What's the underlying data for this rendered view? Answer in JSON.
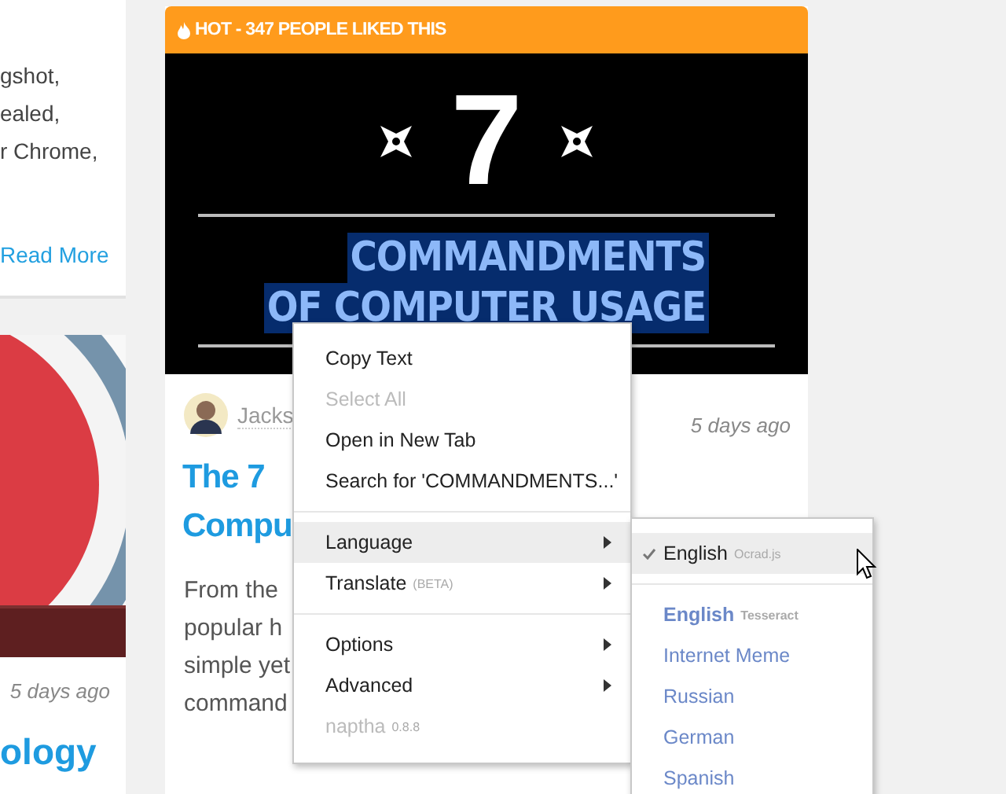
{
  "left_card": {
    "text_lines": [
      "gshot,",
      "ealed,",
      "r Chrome,"
    ],
    "link": "Read More"
  },
  "left_card_2": {
    "time": "5 days ago",
    "title": "ology"
  },
  "main_card": {
    "banner": "HOT - 347 PEOPLE LIKED THIS",
    "image": {
      "number": "7",
      "lines": [
        "COMMANDMENTS",
        "OF COMPUTER USAGE"
      ]
    },
    "author": "Jacks",
    "time": "5 days ago",
    "title_lines": [
      "The 7",
      "Compu"
    ],
    "body_lines": [
      "From the",
      "popular h",
      "simple yet",
      "command"
    ]
  },
  "context_menu": {
    "items": [
      {
        "kind": "item",
        "label": "Copy Text",
        "disabled": false,
        "highlighted": false,
        "submenu": false
      },
      {
        "kind": "item",
        "label": "Select All",
        "disabled": true,
        "highlighted": false,
        "submenu": false
      },
      {
        "kind": "item",
        "label": "Open in New Tab",
        "disabled": false,
        "highlighted": false,
        "submenu": false
      },
      {
        "kind": "item",
        "label": "Search for 'COMMANDMENTS...'",
        "disabled": false,
        "highlighted": false,
        "submenu": false
      },
      {
        "kind": "separator"
      },
      {
        "kind": "item",
        "label": "Language",
        "disabled": false,
        "highlighted": true,
        "submenu": true
      },
      {
        "kind": "item",
        "label": "Translate",
        "note": "(BETA)",
        "disabled": false,
        "highlighted": false,
        "submenu": true
      },
      {
        "kind": "separator"
      },
      {
        "kind": "item",
        "label": "Options",
        "disabled": false,
        "highlighted": false,
        "submenu": true
      },
      {
        "kind": "item",
        "label": "Advanced",
        "disabled": false,
        "highlighted": false,
        "submenu": true
      },
      {
        "kind": "footer",
        "label": "naptha",
        "note": "0.8.8"
      }
    ]
  },
  "language_menu": {
    "items": [
      {
        "kind": "item",
        "label": "English",
        "note": "Ocrad.js",
        "checked": true,
        "highlighted": true,
        "bold": false,
        "available": false
      },
      {
        "kind": "separator"
      },
      {
        "kind": "item",
        "label": "English",
        "note": "Tesseract",
        "checked": false,
        "highlighted": false,
        "bold": true,
        "available": true
      },
      {
        "kind": "item",
        "label": "Internet Meme",
        "checked": false,
        "highlighted": false,
        "bold": false,
        "available": true
      },
      {
        "kind": "item",
        "label": "Russian",
        "checked": false,
        "highlighted": false,
        "bold": false,
        "available": true
      },
      {
        "kind": "item",
        "label": "German",
        "checked": false,
        "highlighted": false,
        "bold": false,
        "available": true
      },
      {
        "kind": "item",
        "label": "Spanish",
        "checked": false,
        "highlighted": false,
        "bold": false,
        "available": true
      }
    ]
  }
}
